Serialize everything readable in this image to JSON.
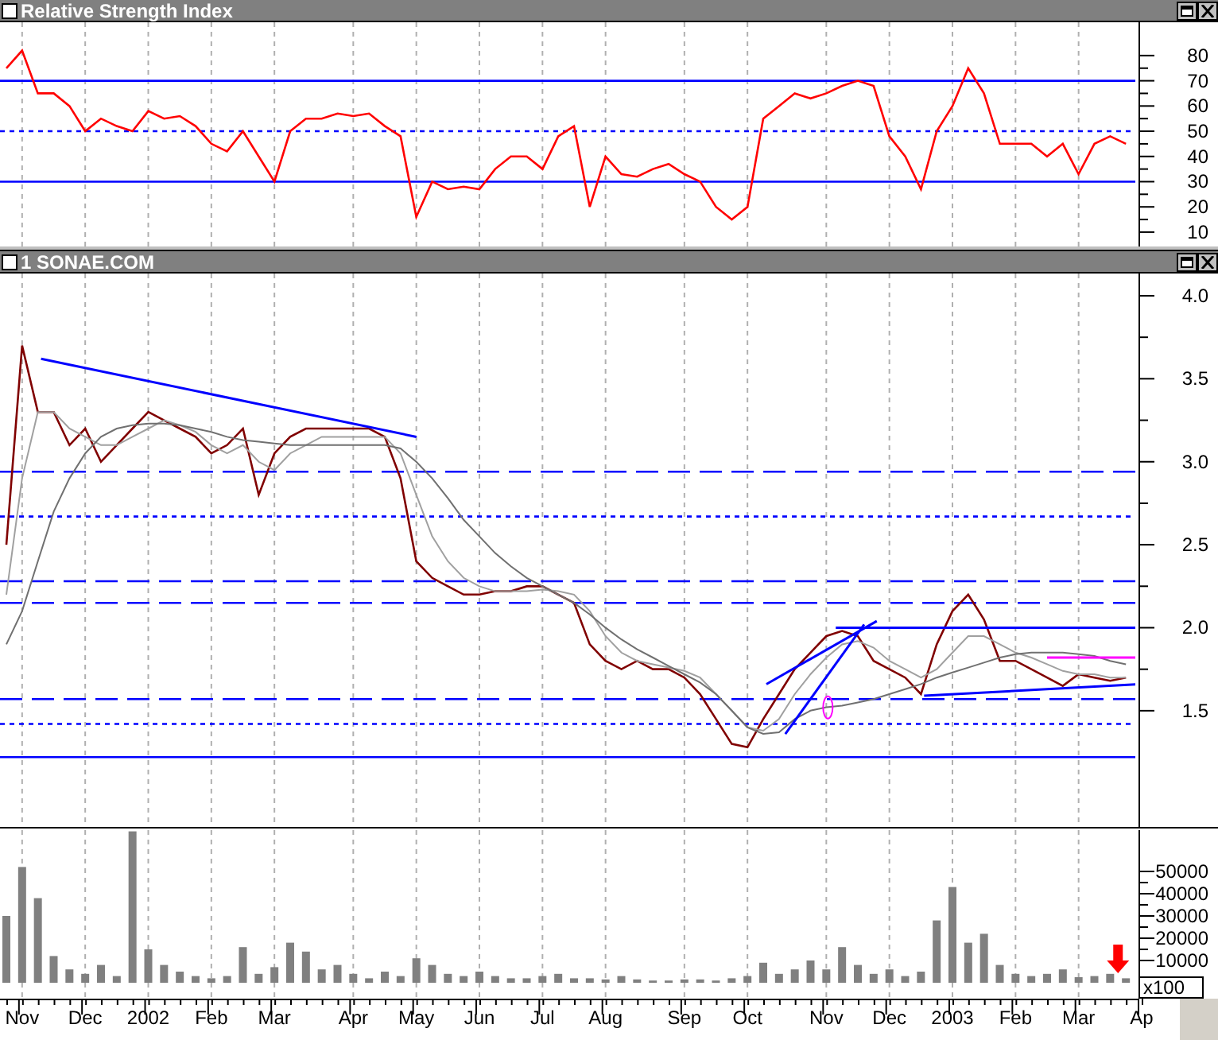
{
  "panels": [
    {
      "kind": "rsi",
      "title": "Relative Strength Index",
      "chart_data": {
        "type": "line",
        "grid": true,
        "ylim": [
          4.3,
          93.2
        ],
        "yticks": [
          {
            "value": 10,
            "label": "10"
          },
          {
            "value": 20,
            "label": "20"
          },
          {
            "value": 30,
            "label": "30"
          },
          {
            "value": 40,
            "label": "40"
          },
          {
            "value": 50,
            "label": "50"
          },
          {
            "value": 60,
            "label": "60"
          },
          {
            "value": 70,
            "label": "70"
          },
          {
            "value": 80,
            "label": "80"
          }
        ],
        "series": [
          {
            "color": "#ff0000",
            "values": [
              75,
              82,
              65,
              65,
              60,
              50,
              55,
              52,
              50,
              58,
              55,
              56,
              52,
              45,
              42,
              50,
              40,
              30,
              50,
              55,
              55,
              57,
              56,
              57,
              52,
              48,
              16,
              30,
              27,
              28,
              27,
              35,
              40,
              40,
              35,
              48,
              52,
              20,
              40,
              33,
              32,
              35,
              37,
              33,
              30,
              20,
              15,
              20,
              55,
              60,
              65,
              63,
              65,
              68,
              70,
              68,
              48,
              40,
              27,
              50,
              60,
              75,
              65,
              45,
              45,
              45,
              40,
              45,
              33,
              45,
              48,
              45
            ]
          }
        ],
        "ref_lines": [
          {
            "axis": "y",
            "value": 70
          },
          {
            "axis": "y",
            "value": 50
          },
          {
            "axis": "y",
            "value": 30
          }
        ]
      }
    },
    {
      "kind": "price",
      "title": "1 SONAE.COM",
      "chart_data": {
        "type": "line",
        "grid": true,
        "ylim": [
          0.8,
          4.134
        ],
        "yticks": [
          {
            "value": 1.5,
            "label": "1.5"
          },
          {
            "value": 2,
            "label": "2.0"
          },
          {
            "value": 2.5,
            "label": "2.5"
          },
          {
            "value": 3,
            "label": "3.0"
          },
          {
            "value": 3.5,
            "label": "3.5"
          },
          {
            "value": 4,
            "label": "4.0"
          }
        ],
        "series": [
          {
            "color": "#800000",
            "values": [
              2.5,
              3.7,
              3.3,
              3.3,
              3.1,
              3.2,
              3.0,
              3.1,
              3.2,
              3.3,
              3.25,
              3.2,
              3.15,
              3.05,
              3.1,
              3.2,
              2.8,
              3.05,
              3.15,
              3.2,
              3.2,
              3.2,
              3.2,
              3.2,
              3.15,
              2.9,
              2.4,
              2.3,
              2.25,
              2.2,
              2.2,
              2.22,
              2.22,
              2.25,
              2.25,
              2.2,
              2.15,
              1.9,
              1.8,
              1.75,
              1.8,
              1.75,
              1.75,
              1.7,
              1.6,
              1.45,
              1.3,
              1.28,
              1.45,
              1.6,
              1.75,
              1.85,
              1.95,
              1.98,
              1.95,
              1.8,
              1.75,
              1.7,
              1.6,
              1.9,
              2.1,
              2.2,
              2.05,
              1.8,
              1.8,
              1.75,
              1.7,
              1.65,
              1.72,
              1.7,
              1.68,
              1.7
            ]
          },
          {
            "color": "#a0a0a0",
            "values": [
              2.2,
              2.9,
              3.3,
              3.3,
              3.2,
              3.15,
              3.1,
              3.1,
              3.15,
              3.2,
              3.25,
              3.22,
              3.18,
              3.1,
              3.05,
              3.1,
              3.0,
              2.95,
              3.05,
              3.1,
              3.15,
              3.15,
              3.15,
              3.15,
              3.15,
              3.05,
              2.8,
              2.55,
              2.4,
              2.3,
              2.25,
              2.22,
              2.22,
              2.22,
              2.23,
              2.22,
              2.2,
              2.1,
              1.95,
              1.85,
              1.8,
              1.78,
              1.76,
              1.74,
              1.7,
              1.6,
              1.5,
              1.4,
              1.38,
              1.45,
              1.6,
              1.72,
              1.82,
              1.9,
              1.92,
              1.88,
              1.8,
              1.75,
              1.7,
              1.75,
              1.85,
              1.95,
              1.95,
              1.9,
              1.85,
              1.82,
              1.78,
              1.74,
              1.72,
              1.72,
              1.7,
              1.7
            ]
          },
          {
            "color": "#707070",
            "values": [
              1.9,
              2.1,
              2.4,
              2.7,
              2.9,
              3.05,
              3.15,
              3.2,
              3.22,
              3.23,
              3.23,
              3.22,
              3.2,
              3.18,
              3.15,
              3.13,
              3.12,
              3.11,
              3.1,
              3.1,
              3.1,
              3.1,
              3.1,
              3.1,
              3.1,
              3.08,
              3.0,
              2.9,
              2.78,
              2.65,
              2.55,
              2.45,
              2.37,
              2.3,
              2.25,
              2.2,
              2.15,
              2.08,
              2.0,
              1.93,
              1.87,
              1.82,
              1.77,
              1.72,
              1.67,
              1.6,
              1.5,
              1.4,
              1.36,
              1.37,
              1.45,
              1.5,
              1.52,
              1.53,
              1.55,
              1.57,
              1.6,
              1.63,
              1.66,
              1.7,
              1.73,
              1.76,
              1.79,
              1.82,
              1.84,
              1.85,
              1.85,
              1.85,
              1.84,
              1.83,
              1.8,
              1.78
            ]
          }
        ],
        "ref_lines": [
          {
            "axis": "y",
            "value": 2.94
          },
          {
            "axis": "y",
            "value": 2.67
          },
          {
            "axis": "y",
            "value": 2.28
          },
          {
            "axis": "y",
            "value": 2.15
          },
          {
            "axis": "y",
            "value": 1.57
          },
          {
            "axis": "y",
            "value": 1.42
          },
          {
            "axis": "y",
            "value": 1.22
          }
        ]
      }
    },
    {
      "kind": "volume",
      "scale_label": "x100",
      "chart_data": {
        "type": "bar",
        "grid": true,
        "ylim": [
          -7143,
          68571
        ],
        "yticks": [
          {
            "value": 10000,
            "label": "10000"
          },
          {
            "value": 20000,
            "label": "20000"
          },
          {
            "value": 30000,
            "label": "30000"
          },
          {
            "value": 40000,
            "label": "40000"
          },
          {
            "value": 50000,
            "label": "50000"
          }
        ],
        "categories": [
          null,
          "Nov",
          null,
          null,
          null,
          "Dec",
          null,
          null,
          null,
          "2002",
          null,
          null,
          null,
          "Feb",
          null,
          null,
          null,
          "Mar",
          null,
          null,
          null,
          null,
          "Apr",
          null,
          null,
          null,
          "May",
          null,
          null,
          null,
          "Jun",
          null,
          null,
          null,
          "Jul",
          null,
          null,
          null,
          "Aug",
          null,
          null,
          null,
          null,
          "Sep",
          null,
          null,
          null,
          "Oct",
          null,
          null,
          null,
          null,
          "Nov",
          null,
          null,
          null,
          "Dec",
          null,
          null,
          null,
          "2003",
          null,
          null,
          null,
          "Feb",
          null,
          null,
          null,
          "Mar",
          null,
          null,
          null,
          "Ap"
        ],
        "series": [
          {
            "color": "#808080",
            "values": [
              30000,
              52000,
              38000,
              12000,
              6000,
              4000,
              8000,
              3000,
              68000,
              15000,
              8000,
              5000,
              3000,
              2000,
              3000,
              16000,
              4000,
              7000,
              18000,
              14000,
              6000,
              8000,
              4000,
              2000,
              5000,
              3000,
              11000,
              8000,
              4000,
              3000,
              5000,
              3000,
              2000,
              2000,
              3000,
              4000,
              2000,
              2000,
              1500,
              3000,
              1500,
              1000,
              1000,
              1500,
              1500,
              1000,
              2000,
              3000,
              9000,
              4000,
              6000,
              10000,
              6000,
              16000,
              8000,
              4000,
              6000,
              3000,
              5000,
              28000,
              43000,
              18000,
              22000,
              8000,
              4000,
              3000,
              4000,
              6000,
              2500,
              3000,
              4000,
              2000,
              null
            ]
          }
        ]
      }
    }
  ]
}
